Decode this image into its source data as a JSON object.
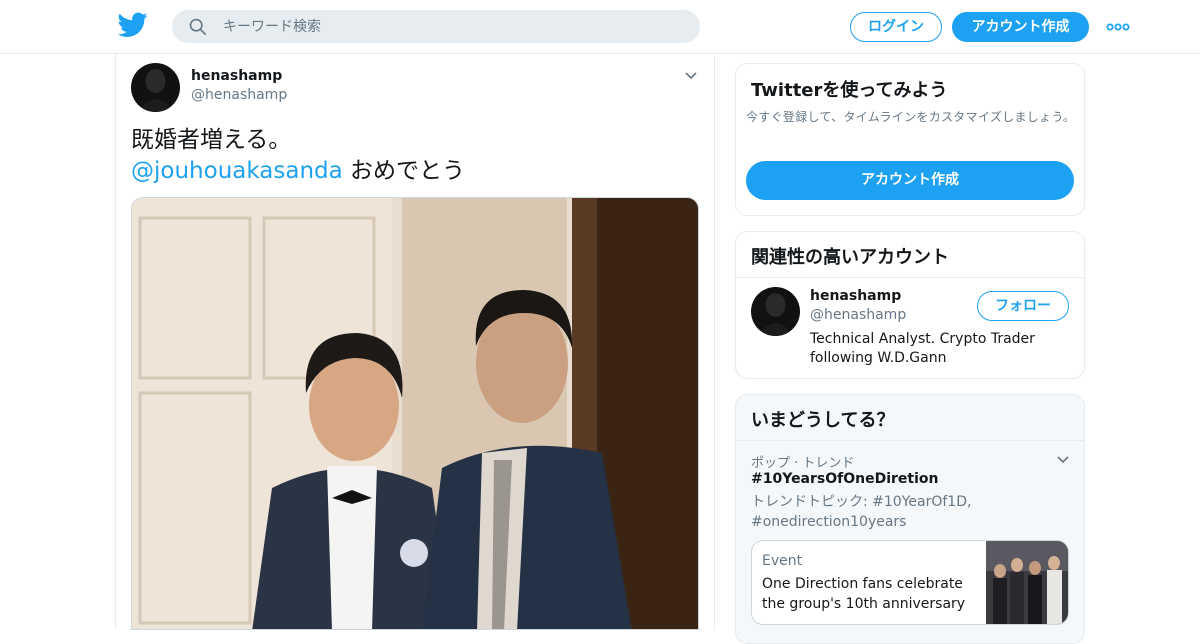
{
  "header": {
    "search_placeholder": "キーワード検索",
    "login_label": "ログイン",
    "signup_label": "アカウント作成",
    "icons": [
      "twitter-bird-icon",
      "search-icon",
      "more-icon"
    ]
  },
  "tweet": {
    "display_name": "henashamp",
    "handle": "@henashamp",
    "text_line1": "既婚者増える。",
    "mention": "@jouhouakasanda",
    "text_line2_rest": " おめでとう"
  },
  "sidebar": {
    "signup_card": {
      "title": "Twitterを使ってみよう",
      "description": "今すぐ登録して、タイムラインをカスタマイズしましょう。",
      "button_label": "アカウント作成"
    },
    "related_card": {
      "title": "関連性の高いアカウント",
      "account": {
        "display_name": "henashamp",
        "handle": "@henashamp",
        "bio": "Technical Analyst. Crypto Trader following W.D.Gann",
        "follow_label": "フォロー"
      }
    },
    "trends_card": {
      "title": "いまどうしてる？",
      "trend": {
        "category": "ポップ · トレンド",
        "name": "#10YearsOfOneDiretion",
        "topics": "トレンドトピック: #10YearOf1D, #onedirection10years"
      },
      "event": {
        "label": "Event",
        "title": "One Direction fans celebrate the group's 10th anniversary"
      }
    }
  },
  "colors": {
    "accent": "#1da1f2",
    "text_primary": "#14171a",
    "text_secondary": "#657786",
    "border": "#e6ecf0",
    "trends_bg": "#f5f8fa"
  }
}
